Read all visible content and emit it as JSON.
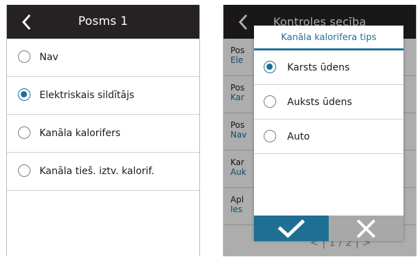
{
  "left_screen": {
    "title": "Posms 1",
    "options": [
      {
        "label": "Nav",
        "selected": false
      },
      {
        "label": "Elektriskais sildītājs",
        "selected": true
      },
      {
        "label": "Kanāla kalorifers",
        "selected": false
      },
      {
        "label": "Kanāla tieš. iztv. kalorif.",
        "selected": false
      }
    ]
  },
  "right_screen": {
    "title": "Kontroles secība",
    "background_rows": [
      {
        "key": "Pos",
        "value": "Ele"
      },
      {
        "key": "Pos",
        "value": "Kar"
      },
      {
        "key": "Pos",
        "value": "Nav"
      },
      {
        "key": "Kar",
        "value": "Auk"
      },
      {
        "key": "Apl",
        "value": "Ies"
      }
    ],
    "pager": "< | 1 / 2 | >",
    "dialog": {
      "title": "Kanāla kalorifera tips",
      "options": [
        {
          "label": "Karsts ūdens",
          "selected": true
        },
        {
          "label": "Auksts ūdens",
          "selected": false
        },
        {
          "label": "Auto",
          "selected": false
        }
      ]
    }
  },
  "colors": {
    "header_bg": "#262223",
    "accent": "#1f6f95",
    "cancel_bg": "#a8a8a8"
  }
}
